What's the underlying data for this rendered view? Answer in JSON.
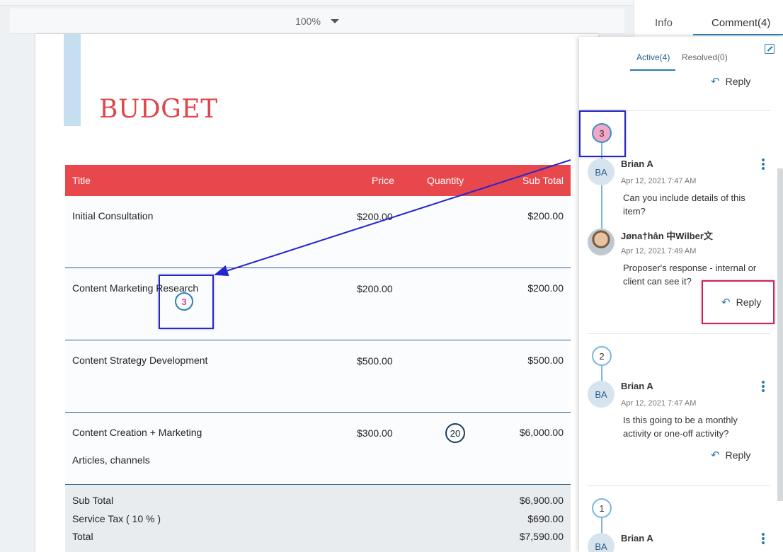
{
  "zoom": {
    "value": "100%"
  },
  "document": {
    "title": "BUDGET",
    "columns": [
      "Title",
      "Price",
      "Quantity",
      "Sub Total"
    ],
    "rows": [
      {
        "title": "Initial Consultation",
        "sub": "",
        "price": "$200.00",
        "qty": "",
        "total": "$200.00"
      },
      {
        "title": "Content Marketing Research",
        "sub": "",
        "price": "$200.00",
        "qty": "",
        "total": "$200.00"
      },
      {
        "title": "Content Strategy Development",
        "sub": "",
        "price": "$500.00",
        "qty": "",
        "total": "$500.00"
      },
      {
        "title": "Content Creation + Marketing",
        "sub": "Articles, channels",
        "price": "$300.00",
        "qty": "20",
        "total": "$6,000.00"
      }
    ],
    "summary": [
      {
        "label": "Sub Total",
        "value": "$6,900.00"
      },
      {
        "label": "Service Tax ( 10 % )",
        "value": "$690.00"
      },
      {
        "label": "Total",
        "value": "$7,590.00"
      }
    ],
    "inline_marker": "3"
  },
  "side_panel": {
    "tabs": {
      "info": "Info",
      "comment": "Comment(4)"
    },
    "subtabs": {
      "active": "Active(4)",
      "resolved": "Resolved(0)"
    },
    "reply_label": "Reply",
    "threads": [
      {
        "marker": "3",
        "comments": [
          {
            "initials": "BA",
            "author": "Brian A",
            "time": "Apr 12, 2021   7:47 AM",
            "text": "Can you include details of this item?"
          },
          {
            "initials": "",
            "author": "Jøna†hân 中Wilber文",
            "time": "Apr 12, 2021   7:49 AM",
            "text": "Proposer's response - internal or client can see it?"
          }
        ]
      },
      {
        "marker": "2",
        "comments": [
          {
            "initials": "BA",
            "author": "Brian A",
            "time": "Apr 12, 2021   7:47 AM",
            "text": "Is this going to be a monthly activity or one-off activity?"
          }
        ]
      },
      {
        "marker": "1",
        "comments": [
          {
            "initials": "BA",
            "author": "Brian A",
            "time": "",
            "text": ""
          }
        ]
      }
    ]
  },
  "colors": {
    "accent_red": "#e8474c",
    "link_blue": "#2a7ab0",
    "annotation_blue": "#2525cf",
    "annotation_pink": "#d21f5f"
  }
}
